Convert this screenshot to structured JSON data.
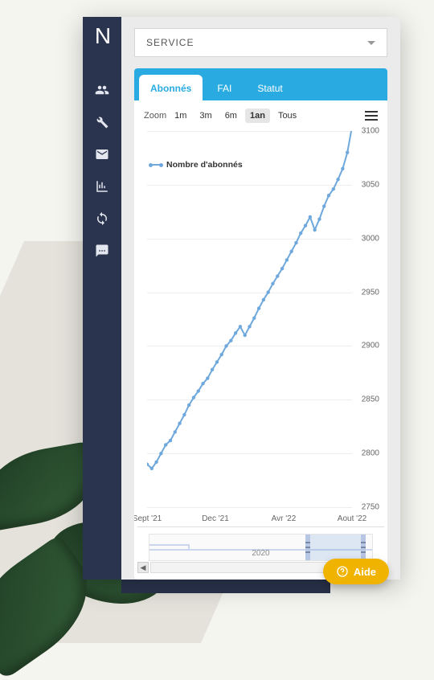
{
  "sidebar": {
    "logo_text": "N",
    "icons": [
      "users-icon",
      "wrench-icon",
      "mail-icon",
      "chart-icon",
      "sync-icon",
      "comment-icon"
    ]
  },
  "selector": {
    "label": "SERVICE"
  },
  "tabs": [
    {
      "label": "Abonnés",
      "active": true
    },
    {
      "label": "FAI",
      "active": false
    },
    {
      "label": "Statut",
      "active": false
    }
  ],
  "zoom": {
    "label": "Zoom",
    "options": [
      "1m",
      "3m",
      "6m",
      "1an",
      "Tous"
    ],
    "active": "1an"
  },
  "legend": {
    "series_name": "Nombre d'abonnés"
  },
  "navigator": {
    "year_label": "2020"
  },
  "help": {
    "label": "Aide"
  },
  "chart_data": {
    "type": "line",
    "title": "",
    "xlabel": "",
    "ylabel": "",
    "ylim": [
      2750,
      3100
    ],
    "y_ticks": [
      2750,
      2800,
      2850,
      2900,
      2950,
      3000,
      3050,
      3100
    ],
    "x_ticks": [
      "Sept '21",
      "Dec '21",
      "Avr '22",
      "Aout '22"
    ],
    "series": [
      {
        "name": "Nombre d'abonnés",
        "color": "#6fa8dc",
        "x": [
          "2021-09",
          "2021-09-08",
          "2021-09-15",
          "2021-09-22",
          "2021-10",
          "2021-10-08",
          "2021-10-15",
          "2021-10-22",
          "2021-11",
          "2021-11-08",
          "2021-11-15",
          "2021-11-22",
          "2021-12",
          "2021-12-08",
          "2021-12-15",
          "2021-12-22",
          "2022-01",
          "2022-01-08",
          "2022-01-15",
          "2022-01-22",
          "2022-02",
          "2022-02-08",
          "2022-02-15",
          "2022-02-22",
          "2022-03",
          "2022-03-08",
          "2022-03-15",
          "2022-03-22",
          "2022-04",
          "2022-04-08",
          "2022-04-15",
          "2022-04-22",
          "2022-05",
          "2022-05-08",
          "2022-05-15",
          "2022-05-22",
          "2022-06",
          "2022-06-08",
          "2022-06-15",
          "2022-06-22",
          "2022-07",
          "2022-07-08",
          "2022-07-15",
          "2022-07-22",
          "2022-08"
        ],
        "values": [
          2790,
          2786,
          2792,
          2800,
          2808,
          2812,
          2820,
          2828,
          2836,
          2845,
          2852,
          2858,
          2865,
          2870,
          2878,
          2885,
          2892,
          2900,
          2905,
          2912,
          2918,
          2910,
          2918,
          2926,
          2935,
          2943,
          2950,
          2958,
          2965,
          2972,
          2980,
          2988,
          2996,
          3005,
          3012,
          3020,
          3008,
          3018,
          3030,
          3040,
          3046,
          3055,
          3065,
          3080,
          3104
        ]
      }
    ]
  }
}
